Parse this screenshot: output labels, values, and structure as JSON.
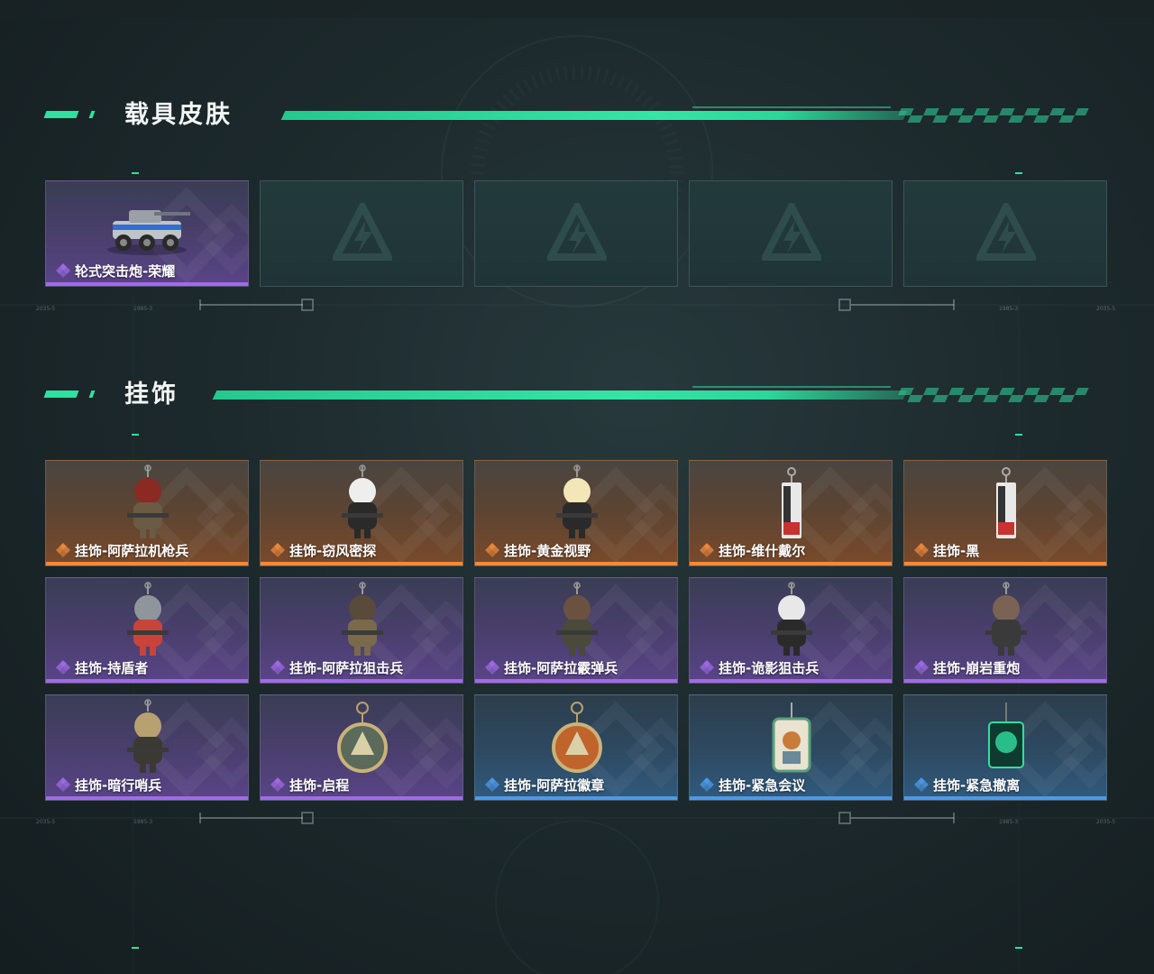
{
  "sections": {
    "vehicle_skins": {
      "title": "载具皮肤",
      "items": [
        {
          "label": "轮式突击炮-荣耀",
          "rarity": "purple",
          "icon": "armored-vehicle-icon"
        },
        {
          "label": "",
          "rarity": "empty",
          "icon": "placeholder-logo-icon"
        },
        {
          "label": "",
          "rarity": "empty",
          "icon": "placeholder-logo-icon"
        },
        {
          "label": "",
          "rarity": "empty",
          "icon": "placeholder-logo-icon"
        },
        {
          "label": "",
          "rarity": "empty",
          "icon": "placeholder-logo-icon"
        }
      ]
    },
    "charms": {
      "title": "挂饰",
      "items": [
        {
          "label": "挂饰-阿萨拉机枪兵",
          "rarity": "orange",
          "icon": "machine-gunner-charm-icon"
        },
        {
          "label": "挂饰-窃风密探",
          "rarity": "orange",
          "icon": "wind-spy-charm-icon"
        },
        {
          "label": "挂饰-黄金视野",
          "rarity": "orange",
          "icon": "golden-vision-charm-icon"
        },
        {
          "label": "挂饰-维什戴尔",
          "rarity": "orange",
          "icon": "card-tag-charm-icon"
        },
        {
          "label": "挂饰-黑",
          "rarity": "orange",
          "icon": "card-tag-charm-icon"
        },
        {
          "label": "挂饰-持盾者",
          "rarity": "purple",
          "icon": "shield-bearer-charm-icon"
        },
        {
          "label": "挂饰-阿萨拉狙击兵",
          "rarity": "purple",
          "icon": "sniper-charm-icon"
        },
        {
          "label": "挂饰-阿萨拉霰弹兵",
          "rarity": "purple",
          "icon": "shotgunner-charm-icon"
        },
        {
          "label": "挂饰-诡影狙击兵",
          "rarity": "purple",
          "icon": "shadow-sniper-charm-icon"
        },
        {
          "label": "挂饰-崩岩重炮",
          "rarity": "purple",
          "icon": "heavy-gunner-charm-icon"
        },
        {
          "label": "挂饰-暗行哨兵",
          "rarity": "purple",
          "icon": "sentry-charm-icon"
        },
        {
          "label": "挂饰-启程",
          "rarity": "purple",
          "icon": "ring-medal-charm-icon"
        },
        {
          "label": "挂饰-阿萨拉徽章",
          "rarity": "blue",
          "icon": "badge-charm-icon"
        },
        {
          "label": "挂饰-紧急会议",
          "rarity": "blue",
          "icon": "emergency-meeting-charm-icon"
        },
        {
          "label": "挂饰-紧急撤离",
          "rarity": "blue",
          "icon": "emergency-evac-charm-icon"
        }
      ]
    }
  },
  "colors": {
    "accent": "#2fe0a0",
    "rarity_orange": "#f08a3c",
    "rarity_purple": "#a06be8",
    "rarity_blue": "#4d9ae8"
  },
  "deco_text": {
    "left": "2035-5",
    "left2": "1985-3",
    "right": "1985-3",
    "right2": "2035-5"
  }
}
